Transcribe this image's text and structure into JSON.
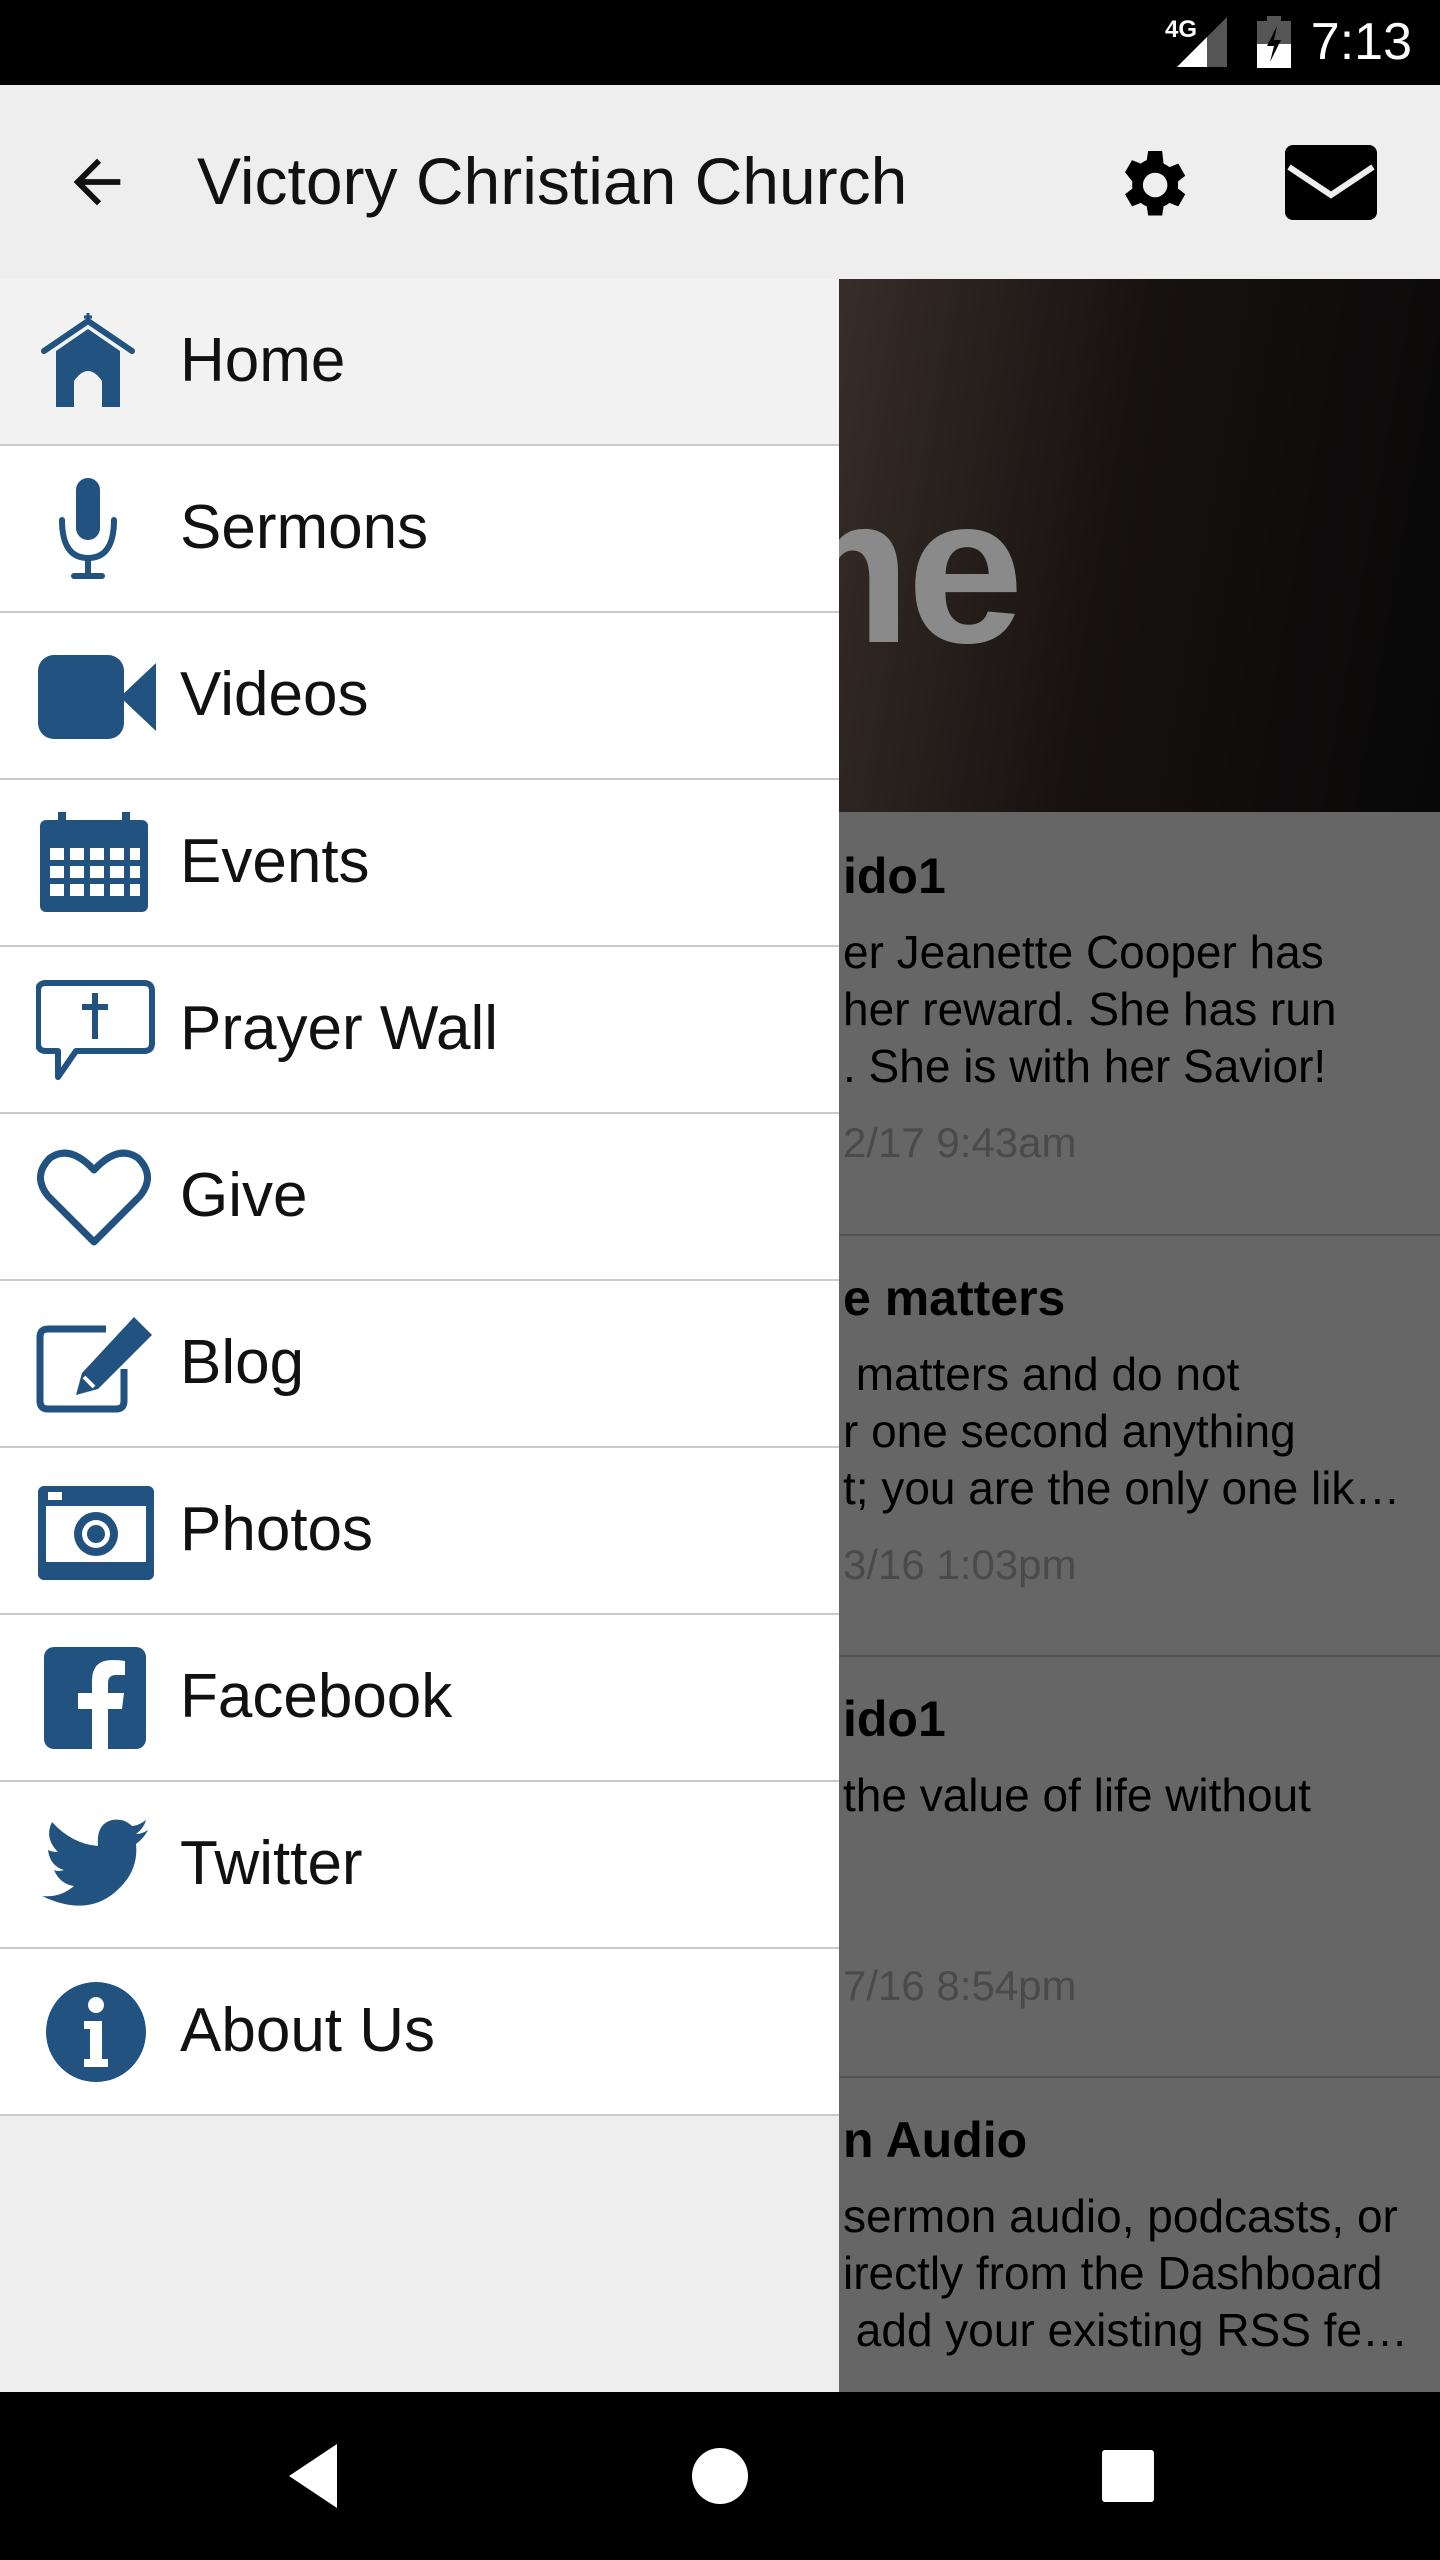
{
  "status_bar": {
    "network": "4G",
    "time": "7:13"
  },
  "app_bar": {
    "title": "Victory Christian Church",
    "back_icon": "arrow-left-icon",
    "settings_icon": "gear-icon",
    "messages_icon": "envelope-icon"
  },
  "accent_color": "#22527f",
  "drawer": {
    "items": [
      {
        "label": "Home",
        "icon": "church-icon",
        "active": true
      },
      {
        "label": "Sermons",
        "icon": "microphone-icon"
      },
      {
        "label": "Videos",
        "icon": "video-camera-icon"
      },
      {
        "label": "Events",
        "icon": "calendar-icon"
      },
      {
        "label": "Prayer Wall",
        "icon": "speech-bubble-cross-icon"
      },
      {
        "label": "Give",
        "icon": "heart-icon"
      },
      {
        "label": "Blog",
        "icon": "edit-icon"
      },
      {
        "label": "Photos",
        "icon": "camera-icon"
      },
      {
        "label": "Facebook",
        "icon": "facebook-icon"
      },
      {
        "label": "Twitter",
        "icon": "twitter-icon"
      },
      {
        "label": "About Us",
        "icon": "info-icon"
      }
    ]
  },
  "content": {
    "hero_text": "ome",
    "cards": [
      {
        "title": "ido1",
        "lines": [
          "er Jeanette Cooper has",
          "her reward. She has run",
          ". She is with her Savior!"
        ],
        "date": "2/17 9:43am"
      },
      {
        "title": "e matters",
        "lines": [
          " matters and do not",
          "r one second anything",
          "t; you are the only one lik…"
        ],
        "date": "3/16 1:03pm"
      },
      {
        "title": "ido1",
        "lines": [
          "the value of life without"
        ],
        "date": "7/16 8:54pm"
      },
      {
        "title": "n Audio",
        "lines": [
          "sermon audio, podcasts, or",
          "irectly from the Dashboard",
          " add your existing RSS fe…"
        ],
        "date": ""
      }
    ]
  },
  "nav_bar": {
    "back": "triangle-back-icon",
    "home": "circle-home-icon",
    "recents": "square-recents-icon"
  }
}
